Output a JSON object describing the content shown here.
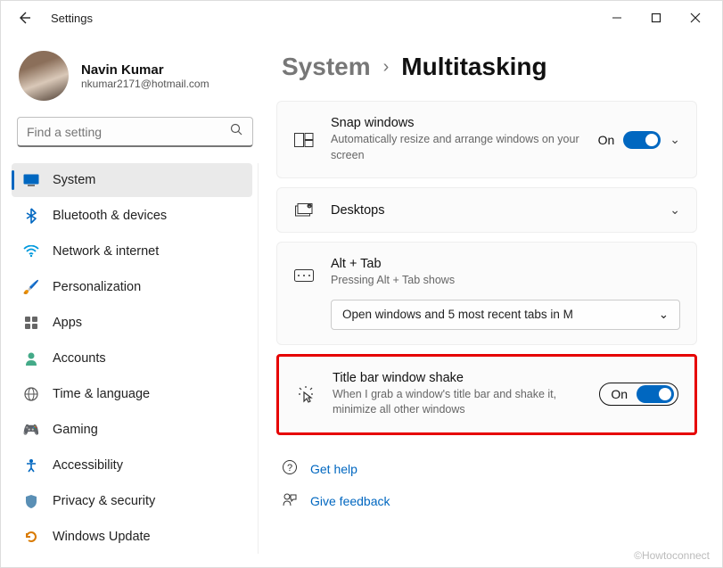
{
  "app_title": "Settings",
  "profile": {
    "name": "Navin Kumar",
    "email": "nkumar2171@hotmail.com"
  },
  "search": {
    "placeholder": "Find a setting"
  },
  "sidebar": {
    "items": [
      {
        "label": "System",
        "icon": "🖥️",
        "selected": true
      },
      {
        "label": "Bluetooth & devices",
        "icon": "bt"
      },
      {
        "label": "Network & internet",
        "icon": "wifi"
      },
      {
        "label": "Personalization",
        "icon": "🖌️"
      },
      {
        "label": "Apps",
        "icon": "▦"
      },
      {
        "label": "Accounts",
        "icon": "👤"
      },
      {
        "label": "Time & language",
        "icon": "🌐"
      },
      {
        "label": "Gaming",
        "icon": "🎮"
      },
      {
        "label": "Accessibility",
        "icon": "♿"
      },
      {
        "label": "Privacy & security",
        "icon": "🔒"
      },
      {
        "label": "Windows Update",
        "icon": "🔄"
      }
    ]
  },
  "breadcrumb": {
    "parent": "System",
    "current": "Multitasking"
  },
  "cards": {
    "snap": {
      "title": "Snap windows",
      "desc": "Automatically resize and arrange windows on your screen",
      "state": "On"
    },
    "desktops": {
      "title": "Desktops"
    },
    "alttab": {
      "title": "Alt + Tab",
      "desc": "Pressing Alt + Tab shows",
      "dropdown": "Open windows and 5 most recent tabs in M"
    },
    "shake": {
      "title": "Title bar window shake",
      "desc": "When I grab a window's title bar and shake it, minimize all other windows",
      "state": "On"
    }
  },
  "help": {
    "get_help": "Get help",
    "feedback": "Give feedback"
  },
  "watermark": "©Howtoconnect"
}
